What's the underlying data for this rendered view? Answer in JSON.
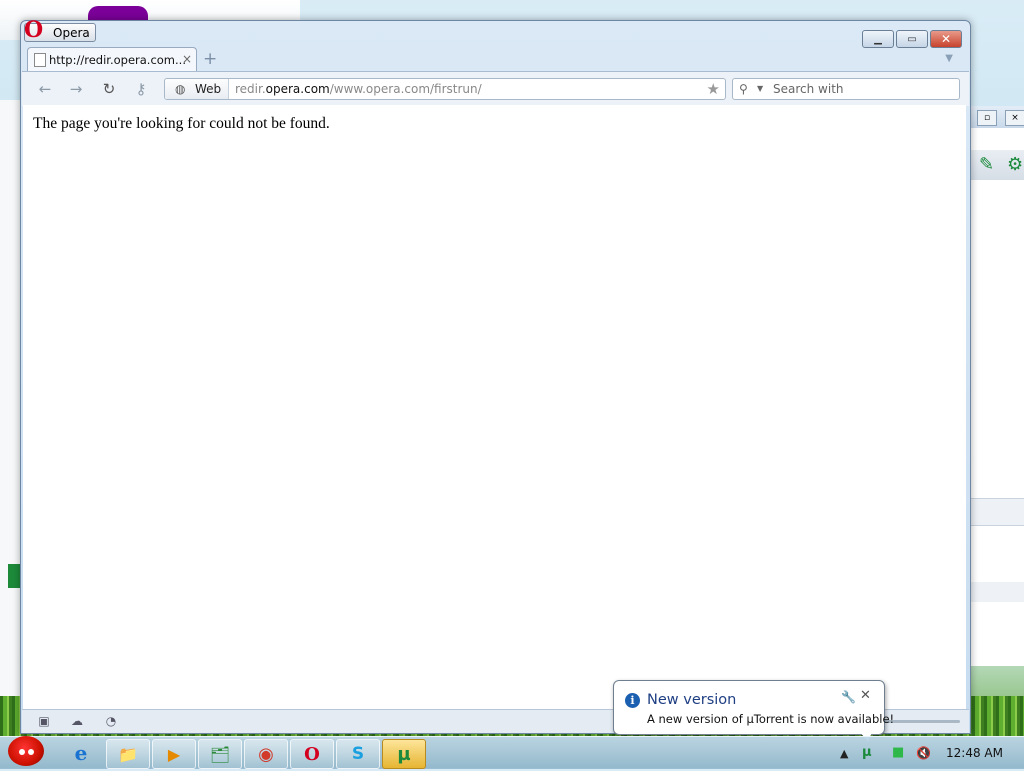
{
  "browser": {
    "menu_label": "Opera",
    "tab": {
      "title": "http://redir.opera.com...",
      "close_glyph": "×"
    },
    "new_tab_glyph": "+",
    "address": {
      "mode_label": "Web",
      "url_prefix": "redir.",
      "url_domain": "opera.com",
      "url_path": "/www.opera.com/firstrun/"
    },
    "search": {
      "placeholder": "Search with"
    },
    "page_message": "The page you're looking for could not be found."
  },
  "notification": {
    "title": "New version",
    "message": "A new version of µTorrent is now available!",
    "icon": "info-icon"
  },
  "taskbar": {
    "apps": [
      {
        "name": "internet-explorer",
        "glyph": "e"
      },
      {
        "name": "windows-explorer",
        "glyph": "📁"
      },
      {
        "name": "media-player",
        "glyph": "▶"
      },
      {
        "name": "file-manager",
        "glyph": "🗂"
      },
      {
        "name": "chrome",
        "glyph": "◉"
      },
      {
        "name": "opera",
        "glyph": "O"
      },
      {
        "name": "skype",
        "glyph": "S"
      },
      {
        "name": "utorrent",
        "glyph": "µ"
      }
    ],
    "clock": "12:48 AM"
  },
  "colors": {
    "opera_red": "#d4001f",
    "notification_title": "#1f3f84",
    "utorrent_green": "#1c8a3c"
  }
}
